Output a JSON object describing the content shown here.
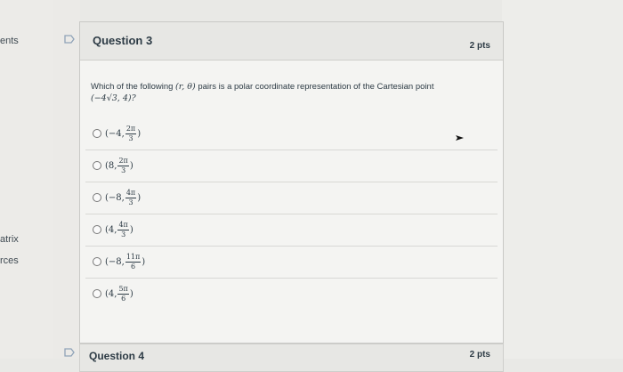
{
  "sidebar": {
    "items": [
      {
        "label": "ents"
      },
      {
        "label": "atrix"
      },
      {
        "label": "rces"
      }
    ]
  },
  "question": {
    "title": "Question 3",
    "points": "2 pts",
    "prompt_before": "Which of the following ",
    "prompt_math": "(r, θ)",
    "prompt_after": " pairs is a polar coordinate representation of the Cartesian point",
    "point_math": "(−4√3, 4)?",
    "answers": [
      {
        "prefix": "(−4,",
        "num": "2π",
        "den": "3",
        "suffix": ")"
      },
      {
        "prefix": "(8,",
        "num": "2π",
        "den": "3",
        "suffix": ")"
      },
      {
        "prefix": "(−8,",
        "num": "4π",
        "den": "3",
        "suffix": ")"
      },
      {
        "prefix": "(4,",
        "num": "4π",
        "den": "3",
        "suffix": ")"
      },
      {
        "prefix": "(−8,",
        "num": "11π",
        "den": "6",
        "suffix": ")"
      },
      {
        "prefix": "(4,",
        "num": "5π",
        "den": "6",
        "suffix": ")"
      }
    ]
  },
  "next_question": {
    "title": "Question 4",
    "points": "2 pts"
  },
  "colors": {
    "accent_flag": "#8fa3b8",
    "text": "#2d3b45"
  }
}
